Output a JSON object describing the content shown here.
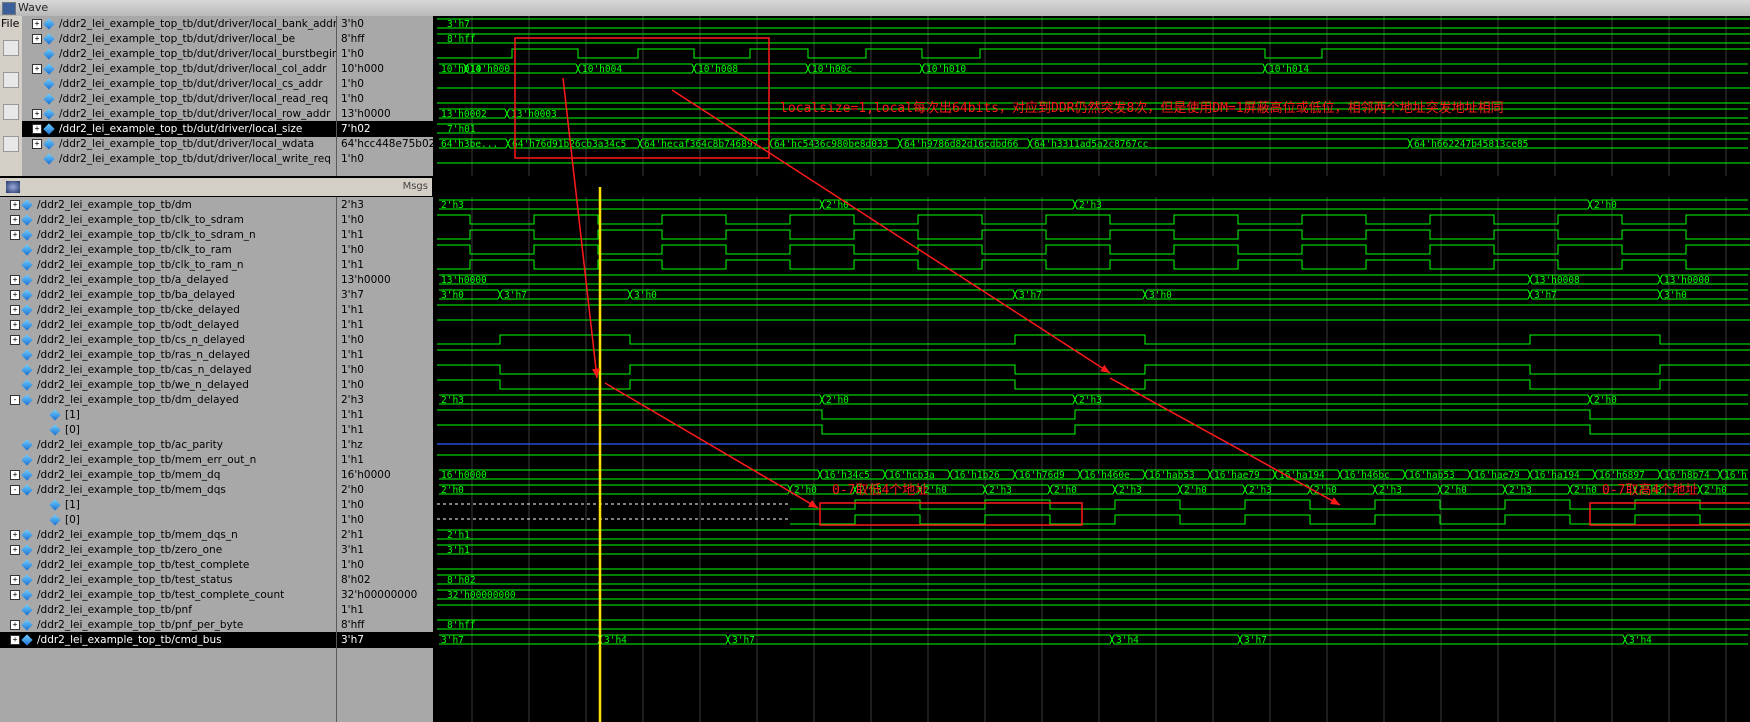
{
  "window": {
    "title": "Wave",
    "menu_file": "File"
  },
  "msgs_label": "Msgs",
  "top_signals": [
    {
      "exp": "+",
      "name": "/ddr2_lei_example_top_tb/dut/driver/local_bank_addr",
      "value": "3'h0",
      "sel": false
    },
    {
      "exp": "+",
      "name": "/ddr2_lei_example_top_tb/dut/driver/local_be",
      "value": "8'hff",
      "sel": false
    },
    {
      "exp": "",
      "name": "/ddr2_lei_example_top_tb/dut/driver/local_burstbegin",
      "value": "1'h0",
      "sel": false
    },
    {
      "exp": "+",
      "name": "/ddr2_lei_example_top_tb/dut/driver/local_col_addr",
      "value": "10'h000",
      "sel": false
    },
    {
      "exp": "",
      "name": "/ddr2_lei_example_top_tb/dut/driver/local_cs_addr",
      "value": "1'h0",
      "sel": false
    },
    {
      "exp": "",
      "name": "/ddr2_lei_example_top_tb/dut/driver/local_read_req",
      "value": "1'h0",
      "sel": false
    },
    {
      "exp": "+",
      "name": "/ddr2_lei_example_top_tb/dut/driver/local_row_addr",
      "value": "13'h0000",
      "sel": false
    },
    {
      "exp": "+",
      "name": "/ddr2_lei_example_top_tb/dut/driver/local_size",
      "value": "7'h02",
      "sel": true
    },
    {
      "exp": "+",
      "name": "/ddr2_lei_example_top_tb/dut/driver/local_wdata",
      "value": "64'hcc448e75b02...",
      "sel": false
    },
    {
      "exp": "",
      "name": "/ddr2_lei_example_top_tb/dut/driver/local_write_req",
      "value": "1'h0",
      "sel": false
    }
  ],
  "bottom_signals": [
    {
      "exp": "+",
      "indent": 0,
      "name": "/ddr2_lei_example_top_tb/dm",
      "value": "2'h3",
      "sel": false
    },
    {
      "exp": "+",
      "indent": 0,
      "name": "/ddr2_lei_example_top_tb/clk_to_sdram",
      "value": "1'h0",
      "sel": false
    },
    {
      "exp": "+",
      "indent": 0,
      "name": "/ddr2_lei_example_top_tb/clk_to_sdram_n",
      "value": "1'h1",
      "sel": false
    },
    {
      "exp": "",
      "indent": 0,
      "name": "/ddr2_lei_example_top_tb/clk_to_ram",
      "value": "1'h0",
      "sel": false
    },
    {
      "exp": "",
      "indent": 0,
      "name": "/ddr2_lei_example_top_tb/clk_to_ram_n",
      "value": "1'h1",
      "sel": false
    },
    {
      "exp": "+",
      "indent": 0,
      "name": "/ddr2_lei_example_top_tb/a_delayed",
      "value": "13'h0000",
      "sel": false
    },
    {
      "exp": "+",
      "indent": 0,
      "name": "/ddr2_lei_example_top_tb/ba_delayed",
      "value": "3'h7",
      "sel": false
    },
    {
      "exp": "+",
      "indent": 0,
      "name": "/ddr2_lei_example_top_tb/cke_delayed",
      "value": "1'h1",
      "sel": false
    },
    {
      "exp": "+",
      "indent": 0,
      "name": "/ddr2_lei_example_top_tb/odt_delayed",
      "value": "1'h1",
      "sel": false
    },
    {
      "exp": "+",
      "indent": 0,
      "name": "/ddr2_lei_example_top_tb/cs_n_delayed",
      "value": "1'h0",
      "sel": false
    },
    {
      "exp": "",
      "indent": 0,
      "name": "/ddr2_lei_example_top_tb/ras_n_delayed",
      "value": "1'h1",
      "sel": false
    },
    {
      "exp": "",
      "indent": 0,
      "name": "/ddr2_lei_example_top_tb/cas_n_delayed",
      "value": "1'h0",
      "sel": false
    },
    {
      "exp": "",
      "indent": 0,
      "name": "/ddr2_lei_example_top_tb/we_n_delayed",
      "value": "1'h0",
      "sel": false
    },
    {
      "exp": "-",
      "indent": 0,
      "name": "/ddr2_lei_example_top_tb/dm_delayed",
      "value": "2'h3",
      "sel": false
    },
    {
      "exp": "",
      "indent": 1,
      "name": "[1]",
      "value": "1'h1",
      "sel": false
    },
    {
      "exp": "",
      "indent": 1,
      "name": "[0]",
      "value": "1'h1",
      "sel": false
    },
    {
      "exp": "",
      "indent": 0,
      "name": "/ddr2_lei_example_top_tb/ac_parity",
      "value": "1'hz",
      "sel": false
    },
    {
      "exp": "",
      "indent": 0,
      "name": "/ddr2_lei_example_top_tb/mem_err_out_n",
      "value": "1'h1",
      "sel": false
    },
    {
      "exp": "+",
      "indent": 0,
      "name": "/ddr2_lei_example_top_tb/mem_dq",
      "value": "16'h0000",
      "sel": false
    },
    {
      "exp": "-",
      "indent": 0,
      "name": "/ddr2_lei_example_top_tb/mem_dqs",
      "value": "2'h0",
      "sel": false
    },
    {
      "exp": "",
      "indent": 1,
      "name": "[1]",
      "value": "1'h0",
      "sel": false
    },
    {
      "exp": "",
      "indent": 1,
      "name": "[0]",
      "value": "1'h0",
      "sel": false
    },
    {
      "exp": "+",
      "indent": 0,
      "name": "/ddr2_lei_example_top_tb/mem_dqs_n",
      "value": "2'h1",
      "sel": false
    },
    {
      "exp": "+",
      "indent": 0,
      "name": "/ddr2_lei_example_top_tb/zero_one",
      "value": "3'h1",
      "sel": false
    },
    {
      "exp": "",
      "indent": 0,
      "name": "/ddr2_lei_example_top_tb/test_complete",
      "value": "1'h0",
      "sel": false
    },
    {
      "exp": "+",
      "indent": 0,
      "name": "/ddr2_lei_example_top_tb/test_status",
      "value": "8'h02",
      "sel": false
    },
    {
      "exp": "+",
      "indent": 0,
      "name": "/ddr2_lei_example_top_tb/test_complete_count",
      "value": "32'h00000000",
      "sel": false
    },
    {
      "exp": "",
      "indent": 0,
      "name": "/ddr2_lei_example_top_tb/pnf",
      "value": "1'h1",
      "sel": false
    },
    {
      "exp": "+",
      "indent": 0,
      "name": "/ddr2_lei_example_top_tb/pnf_per_byte",
      "value": "8'hff",
      "sel": false
    },
    {
      "exp": "+",
      "indent": 0,
      "name": "/ddr2_lei_example_top_tb/cmd_bus",
      "value": "3'h7",
      "sel": true
    }
  ],
  "top_labels": {
    "bank_addr": "3'h7",
    "be": "8'hff",
    "col": [
      "10'h014",
      "10'h000",
      "10'h004",
      "10'h008",
      "10'h00c",
      "10'h010",
      "10'h014"
    ],
    "row_addr": [
      "13'h0002",
      "13'h0003"
    ],
    "size": "7'h01",
    "wdata": [
      "64'h3be...",
      "64'h76d91b26cb3a34c5",
      "64'hecaf364c8b746897",
      "64'hc5436c980be8d033",
      "64'h9786d82d16cdbd66",
      "64'h3311ad5a2c8767cc",
      "64'h662247b45813ce85"
    ]
  },
  "bottom_labels": {
    "dm": [
      "2'h3",
      "2'h0",
      "2'h3",
      "2'h0"
    ],
    "a_delayed": [
      "13'h0000",
      "13'h0008",
      "13'h0000"
    ],
    "ba_delayed": [
      "3'h0",
      "3'h7",
      "3'h0",
      "3'h7",
      "3'h0",
      "3'h7",
      "3'h0"
    ],
    "dm_delayed": [
      "2'h3",
      "2'h0",
      "2'h3",
      "2'h0"
    ],
    "mem_dq": [
      "16'h0000",
      "16'h34c5",
      "16'hcb3a",
      "16'h1b26",
      "16'h76d9",
      "16'h460e",
      "16'hab53",
      "16'hae79",
      "16'ha194",
      "16'h46bc",
      "16'hab53",
      "16'hae79",
      "16'ha194",
      "16'h6897",
      "16'h8b74",
      "16'h"
    ],
    "mem_dqs": [
      "2'h0",
      "2'h0",
      "2'h3",
      "2'h0",
      "2'h3",
      "2'h0",
      "2'h3",
      "2'h0",
      "2'h3",
      "2'h0",
      "2'h3",
      "2'h0",
      "2'h3",
      "2'h0",
      "2'h3",
      "2'h0"
    ],
    "dqs_n": "2'h1",
    "zero_one": "3'h1",
    "test_status": "8'h02",
    "test_complete_count": "32'h00000000",
    "pnf_per_byte": "8'hff",
    "cmd_bus": [
      "3'h7",
      "3'h4",
      "3'h7",
      "3'h4",
      "3'h7",
      "3'h4"
    ]
  },
  "annotations": {
    "note_top": "localsize=1,local每次出64bits，对应到DDR仍然突发8次，但是使用DM=1屏蔽高位或低位，相邻两个地址突发地址相同",
    "note_low": "0-7取低4个地址",
    "note_high": "0-7取高4个地址"
  },
  "colors": {
    "wave": "#00ff00",
    "cursor": "#ffe000",
    "annotation": "#ff1a1a",
    "highz": "#2a5cff",
    "grid": "#3a3a3a",
    "panel": "#a8a8a8"
  }
}
